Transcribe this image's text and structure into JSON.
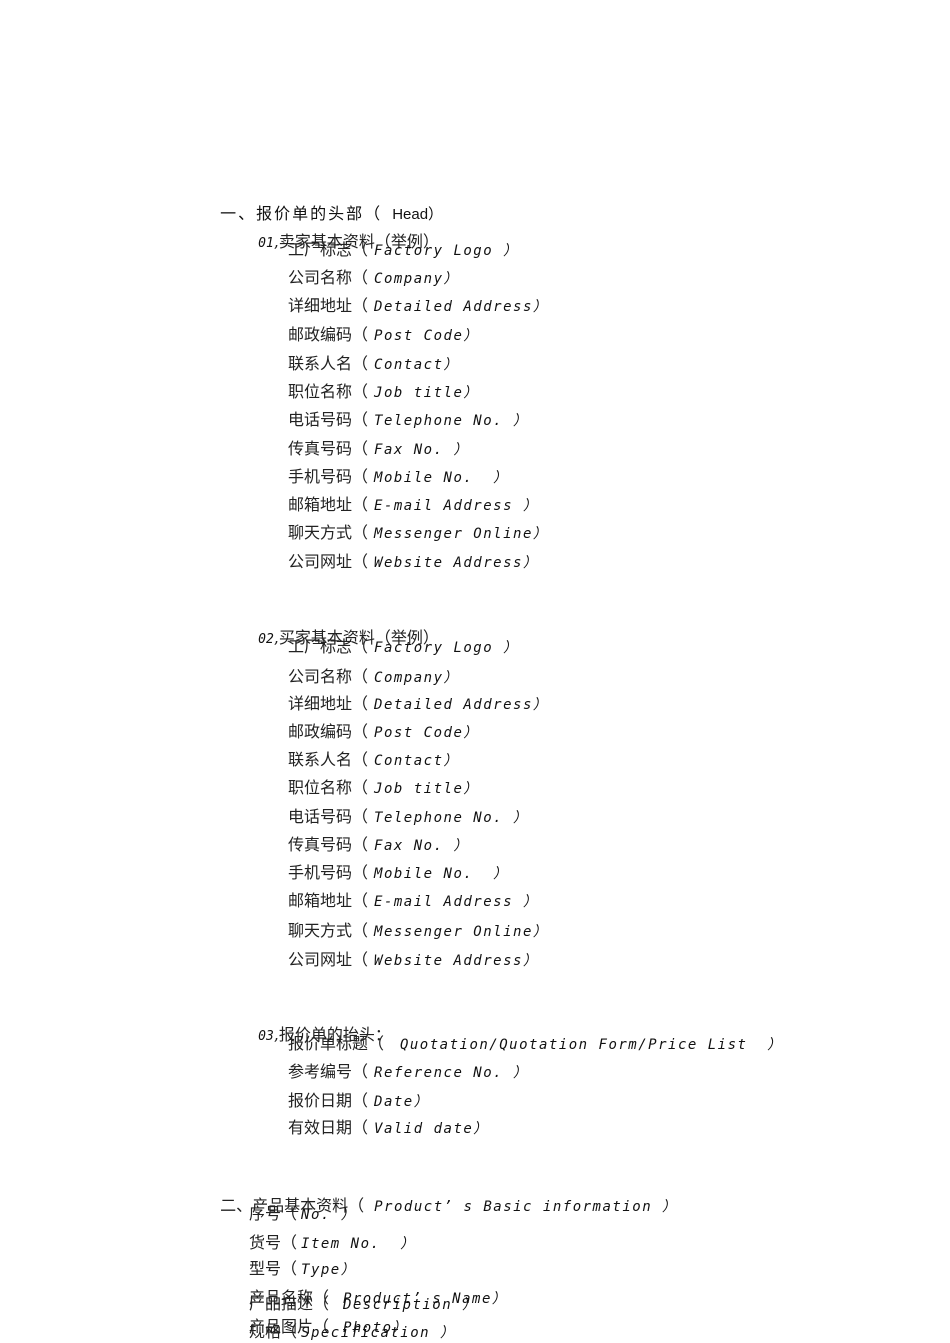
{
  "section1": {
    "title_cn": "一、报价单的头部（",
    "title_en": "Head）",
    "seller": {
      "number": "01",
      "title": ",卖家基本资料（举例）",
      "items": [
        {
          "cn": "工厂标志（",
          "en": "Factory Logo ）"
        },
        {
          "cn": "公司名称（",
          "en": "Company）"
        },
        {
          "cn": "详细地址（",
          "en": "Detailed Address）"
        },
        {
          "cn": "邮政编码（",
          "en": "Post Code）"
        },
        {
          "cn": "联系人名（",
          "en": "Contact）"
        },
        {
          "cn": "职位名称（",
          "en": "Job title）"
        },
        {
          "cn": "电话号码（",
          "en": "Telephone No. ）"
        },
        {
          "cn": "传真号码（",
          "en": "Fax No. ）"
        },
        {
          "cn": "手机号码（",
          "en": "Mobile No.  ）"
        },
        {
          "cn": "邮箱地址（",
          "en": "E-mail Address ）"
        },
        {
          "cn": "聊天方式（",
          "en": "Messenger Online）"
        },
        {
          "cn": "公司网址（",
          "en": "Website Address）"
        }
      ]
    },
    "buyer": {
      "number": "02",
      "title": ",买家基本资料（举例）",
      "items": [
        {
          "cn": "工厂标志（",
          "en": "Factory Logo ）"
        },
        {
          "cn": "公司名称（",
          "en": "Company）"
        },
        {
          "cn": "详细地址（",
          "en": "Detailed Address）"
        },
        {
          "cn": "邮政编码（",
          "en": "Post Code）"
        },
        {
          "cn": "联系人名（",
          "en": "Contact）"
        },
        {
          "cn": "职位名称（",
          "en": "Job title）"
        },
        {
          "cn": "电话号码（",
          "en": "Telephone No. ）"
        },
        {
          "cn": "传真号码（",
          "en": "Fax No. ）"
        },
        {
          "cn": "手机号码（",
          "en": "Mobile No.  ）"
        },
        {
          "cn": "邮箱地址（",
          "en": "E-mail Address ）"
        },
        {
          "cn": "聊天方式（",
          "en": "Messenger Online）"
        },
        {
          "cn": "公司网址（",
          "en": "Website Address）"
        }
      ]
    },
    "header": {
      "number": "03",
      "title": ",报价单的抬头：",
      "items": [
        {
          "cn": "报价单标题（",
          "en": " Quotation/Quotation Form/Price List  ）"
        },
        {
          "cn": "参考编号（",
          "en": "Reference No. ）"
        },
        {
          "cn": "报价日期（",
          "en": "Date）"
        },
        {
          "cn": "有效日期（",
          "en": "Valid date）"
        }
      ]
    }
  },
  "section2": {
    "title_cn": "二、产品基本资料（",
    "title_en": " Product’ s Basic information ）",
    "items": [
      {
        "cn": "序号（",
        "en": "No. ）"
      },
      {
        "cn": "货号（",
        "en": "Item No.  ）"
      },
      {
        "cn": "型号（",
        "en": "Type）"
      },
      {
        "cn": "产品名称（",
        "en": " Product’ s Name）"
      },
      {
        "cn": "产品描述（",
        "en": " Description ）"
      },
      {
        "cn": "产品图片（",
        "en": " Photo）"
      },
      {
        "cn": "规格（",
        "en": "Specification ）"
      }
    ]
  }
}
